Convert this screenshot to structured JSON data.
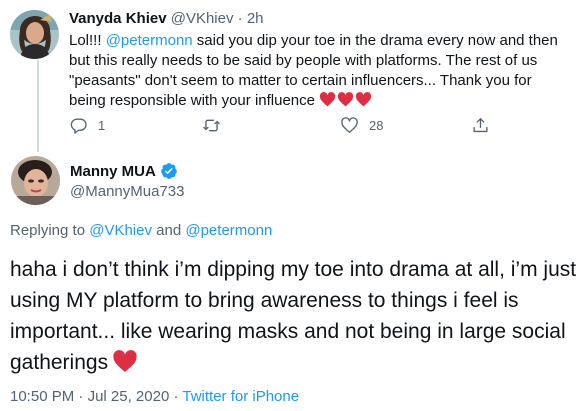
{
  "parent_tweet": {
    "display_name": "Vanyda Khiev",
    "handle": "@VKhiev",
    "separator": "·",
    "timestamp": "2h",
    "text_start": "Lol!!! ",
    "mention": "@petermonn",
    "text_rest": " said you dip your toe in the drama every now and then but this really needs to be said by people with platforms. The rest of us \"peasants\" don't seem to matter to certain influencers... Thank you for being responsible with your influence ",
    "emoji": [
      "red-heart",
      "red-heart",
      "red-heart"
    ],
    "actions": {
      "reply_count": "1",
      "retweet_count": "",
      "like_count": "28"
    }
  },
  "focus_tweet": {
    "display_name": "Manny MUA",
    "verified": true,
    "handle": "@MannyMua733",
    "replying_prefix": "Replying to ",
    "replying_user1": "@VKhiev",
    "replying_and": " and ",
    "replying_user2": "@petermonn",
    "text": "haha i don’t think i’m dipping my toe into drama at all, i’m just using MY platform to bring awareness to things i feel is important... like wearing masks and not being in large social gatherings",
    "emoji": "red-heart",
    "time": "10:50 PM",
    "meta_sep1": " · ",
    "date": "Jul 25, 2020",
    "meta_sep2": " · ",
    "source": "Twitter for iPhone"
  },
  "colors": {
    "accent": "#1d9bf0",
    "secondary_text": "#536471",
    "heart": "#e0245e"
  }
}
